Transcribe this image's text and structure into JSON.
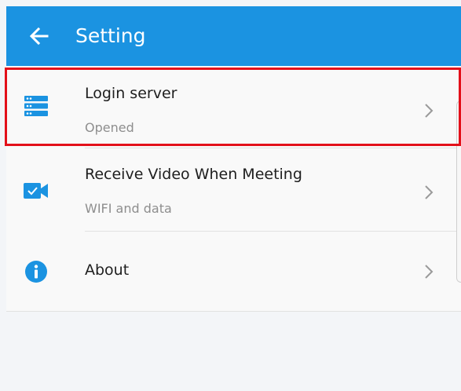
{
  "app_bar": {
    "title": "Setting",
    "back_icon": "arrow-left-icon",
    "background": "#1b93e1"
  },
  "settings": {
    "items": [
      {
        "title": "Login server",
        "subtitle": "Opened",
        "icon": "server-icon"
      },
      {
        "title": "Receive Video When Meeting",
        "subtitle": "WIFI and data",
        "icon": "video-camera-icon"
      },
      {
        "title": "About",
        "subtitle": "",
        "icon": "info-icon"
      }
    ]
  },
  "colors": {
    "accent": "#1b93e1",
    "highlight": "#e3101a",
    "subtitle": "#8e8e8e"
  }
}
